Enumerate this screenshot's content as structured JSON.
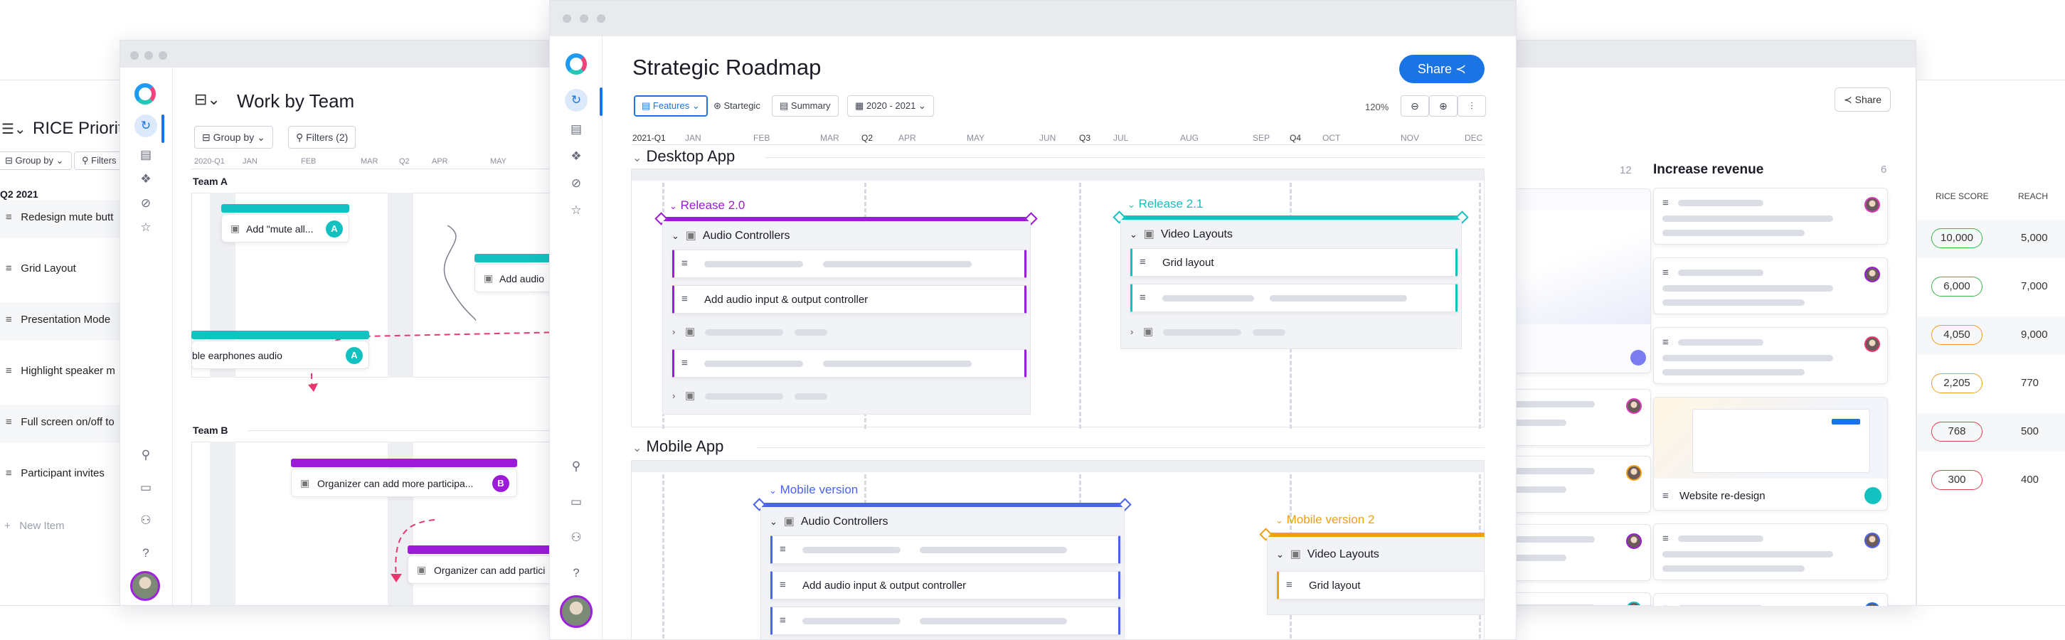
{
  "rice": {
    "title": "RICE Priorit",
    "group_by": "Group by",
    "filters": "Filters",
    "quarter": "Q2 2021",
    "items": [
      "Redesign mute butt",
      "Grid Layout",
      "Presentation Mode",
      "Highlight speaker m",
      "Full screen on/off to",
      "Participant invites"
    ],
    "new_item": "New Item",
    "score_header": "RICE SCORE",
    "reach_header": "REACH",
    "scores": [
      "10,000",
      "6,000",
      "4,050",
      "2,205",
      "768",
      "300"
    ],
    "reach": [
      "5,000",
      "7,000",
      "9,000",
      "770",
      "500",
      "400"
    ],
    "score_colors": [
      "#3bb54a",
      "#3bb54a",
      "#f0a020",
      "#f0a020",
      "#e04050",
      "#e04050"
    ]
  },
  "team": {
    "title": "Work by Team",
    "group_by": "Group by",
    "filters": "Filters (2)",
    "months": [
      "2020-Q1",
      "JAN",
      "FEB",
      "MAR",
      "Q2",
      "APR",
      "MAY"
    ],
    "team_a": "Team A",
    "team_b": "Team B",
    "cards": [
      "Add \"mute all...",
      "Add audio",
      "ble earphones audio",
      "Organizer can add more participa...",
      "Organizer can add partici"
    ],
    "badges": [
      "A",
      "A",
      "B"
    ]
  },
  "roadmap": {
    "title": "Strategic Roadmap",
    "share": "Share",
    "features": "Features",
    "strategic": "Startegic",
    "summary": "Summary",
    "range": "2020 - 2021",
    "zoom": "120%",
    "months": [
      "2021-Q1",
      "JAN",
      "FEB",
      "MAR",
      "Q2",
      "APR",
      "MAY",
      "JUN",
      "Q3",
      "JUL",
      "AUG",
      "SEP",
      "Q4",
      "OCT",
      "NOV",
      "DEC"
    ],
    "desktop": "Desktop App",
    "mobile": "Mobile App",
    "release20": "Release 2.0",
    "release21": "Release 2.1",
    "mobile_version": "Mobile version",
    "mobile_version2": "Mobile version 2",
    "audio_controllers": "Audio Controllers",
    "video_layouts": "Video Layouts",
    "grid_layout": "Grid layout",
    "audio_io": "Add audio input & output controller",
    "colors": {
      "release20": "#9b1bd8",
      "release21": "#14c1c1",
      "mobile": "#4a63f0",
      "mobile2": "#f2a010",
      "accent": "#1b74e4"
    }
  },
  "board": {
    "column_count_left": "12",
    "column_title": "Increase revenue",
    "column_count": "6",
    "share": "Share",
    "website_redesign": "Website re-design"
  }
}
